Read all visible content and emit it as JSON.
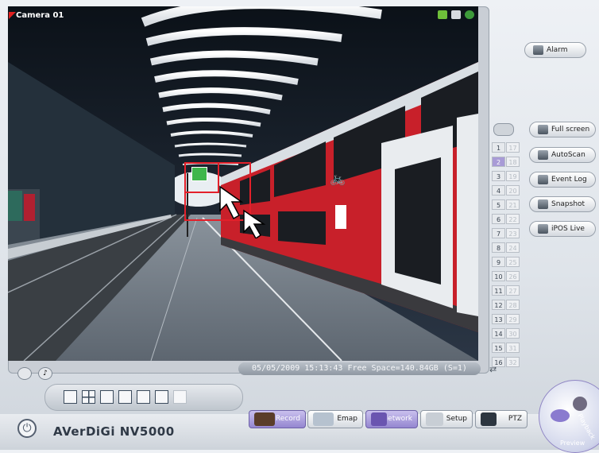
{
  "camera": {
    "title": "Camera 01"
  },
  "status_bar": {
    "text": "05/05/2009 15:13:43  Free Space=140.84GB (S=1)"
  },
  "channels": {
    "left": [
      "1",
      "2",
      "3",
      "4",
      "5",
      "6",
      "7",
      "8",
      "9",
      "10",
      "11",
      "12",
      "13",
      "14",
      "15",
      "16"
    ],
    "right": [
      "17",
      "18",
      "19",
      "20",
      "21",
      "22",
      "23",
      "24",
      "25",
      "26",
      "27",
      "28",
      "29",
      "30",
      "31",
      "32"
    ],
    "selected": "2"
  },
  "right_buttons": {
    "alarm": "Alarm",
    "full_screen": "Full screen",
    "autoscan": "AutoScan",
    "event_log": "Event Log",
    "snapshot": "Snapshot",
    "ipos_live": "iPOS Live"
  },
  "bottom_buttons": {
    "record": "Record",
    "emap": "Emap",
    "network": "Network",
    "setup": "Setup",
    "ptz": "PTZ"
  },
  "brand": "AVerDiGi NV5000",
  "dial": {
    "playback": "Playback",
    "preview": "Preview"
  },
  "colors": {
    "roi": "#e3202a",
    "accent": "#a89bd6",
    "train": "#c8202a"
  }
}
